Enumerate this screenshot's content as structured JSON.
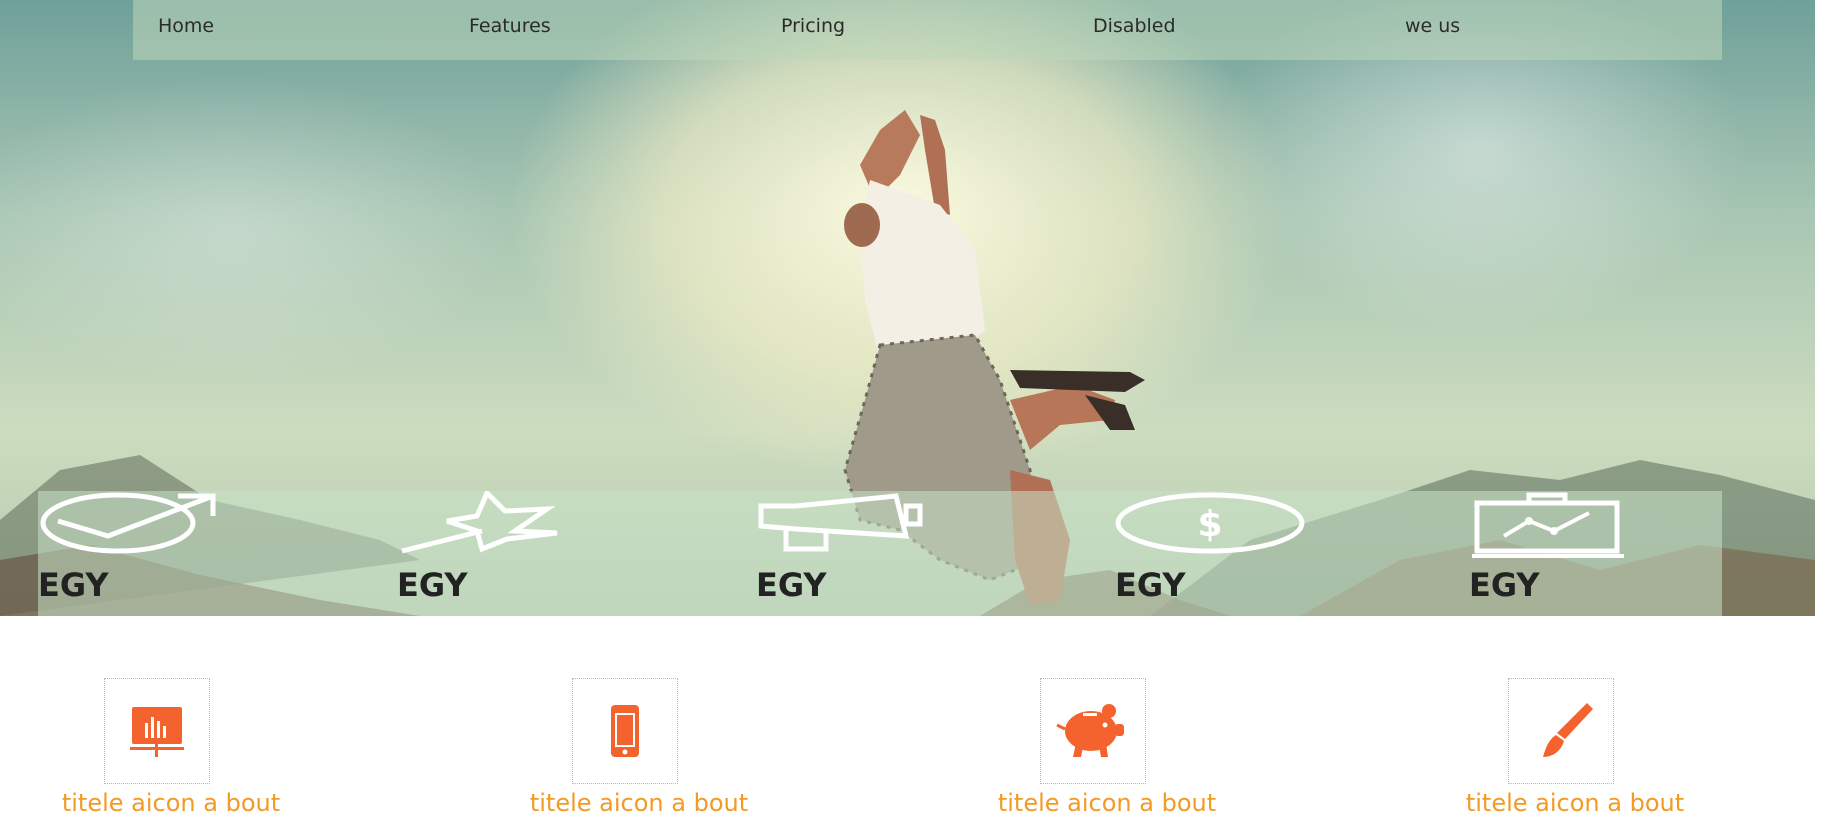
{
  "nav": {
    "items": [
      {
        "label": "Home"
      },
      {
        "label": "Features"
      },
      {
        "label": "Pricing"
      },
      {
        "label": "Disabled"
      },
      {
        "label": "we us"
      }
    ]
  },
  "features": {
    "items": [
      {
        "label": "EGY",
        "icon": "target-arrow-icon"
      },
      {
        "label": "EGY",
        "icon": "star-icon"
      },
      {
        "label": "EGY",
        "icon": "megaphone-icon"
      },
      {
        "label": "EGY",
        "icon": "dollar-coin-icon"
      },
      {
        "label": "EGY",
        "icon": "briefcase-chart-icon"
      }
    ]
  },
  "services": {
    "items": [
      {
        "title": "titele aicon a bout",
        "icon": "presentation-chart-icon"
      },
      {
        "title": "titele aicon a bout",
        "icon": "mobile-phone-icon"
      },
      {
        "title": "titele aicon a bout",
        "icon": "piggy-bank-icon"
      },
      {
        "title": "titele aicon a bout",
        "icon": "paint-brush-icon"
      }
    ]
  },
  "colors": {
    "accent_orange": "#f39a25",
    "icon_orange": "#f4622e",
    "nav_text": "#2b2b2b"
  }
}
